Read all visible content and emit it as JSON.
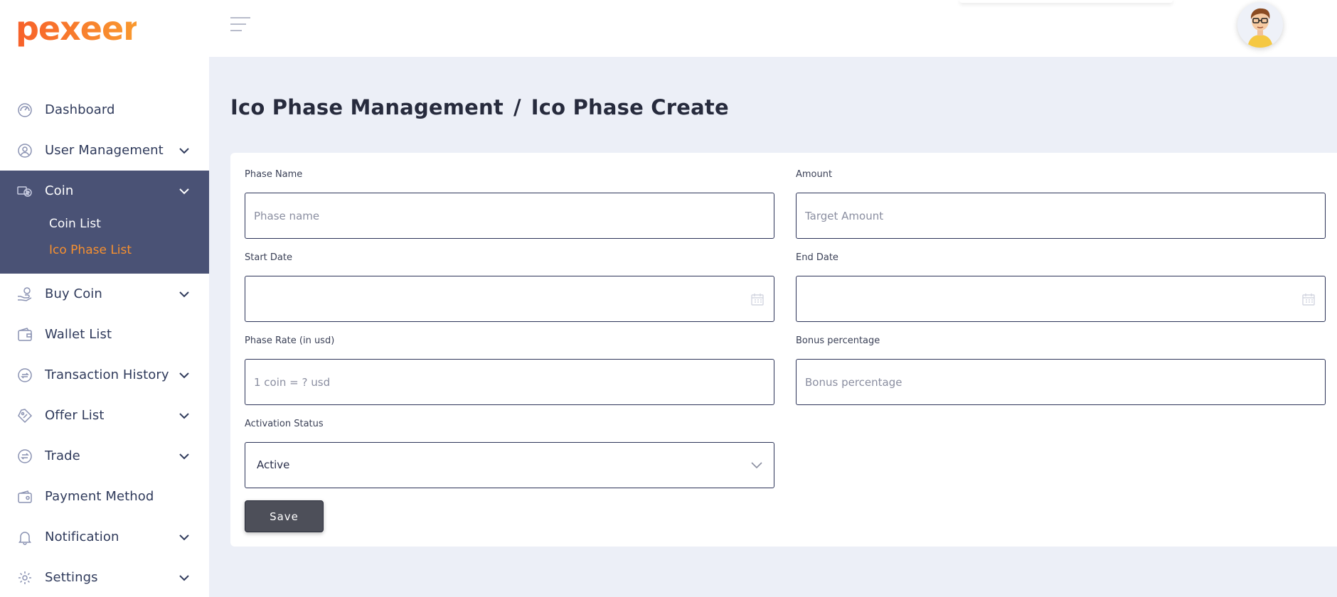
{
  "brand": {
    "name": "pexeer",
    "color": "#f7702b"
  },
  "colors": {
    "sidebar_active_bg": "#4a5275",
    "active_sub": "#f7902f",
    "page_bg": "#eceff7"
  },
  "sidebar": {
    "items": [
      {
        "label": "Dashboard",
        "icon": "speedometer-icon",
        "has_children": false
      },
      {
        "label": "User Management",
        "icon": "user-circle-icon",
        "has_children": true
      },
      {
        "label": "Coin",
        "icon": "coins-icon",
        "has_children": true,
        "open": true,
        "children": [
          {
            "label": "Coin List"
          },
          {
            "label": "Ico Phase List",
            "active": true
          }
        ]
      },
      {
        "label": "Buy Coin",
        "icon": "hand-coin-icon",
        "has_children": true
      },
      {
        "label": "Wallet List",
        "icon": "wallet-icon",
        "has_children": false
      },
      {
        "label": "Transaction History",
        "icon": "transaction-icon",
        "has_children": true
      },
      {
        "label": "Offer List",
        "icon": "offer-tag-icon",
        "has_children": true
      },
      {
        "label": "Trade",
        "icon": "exchange-icon",
        "has_children": true
      },
      {
        "label": "Payment Method",
        "icon": "payment-wallet-icon",
        "has_children": false
      },
      {
        "label": "Notification",
        "icon": "bell-icon",
        "has_children": true
      },
      {
        "label": "Settings",
        "icon": "gear-icon",
        "has_children": true
      }
    ]
  },
  "header": {
    "menu_icon": "hamburger-icon",
    "avatar": "user-avatar"
  },
  "breadcrumb": {
    "parent": "Ico Phase Management",
    "separator": "/",
    "current": "Ico Phase Create"
  },
  "form": {
    "phase_name": {
      "label": "Phase Name",
      "placeholder": "Phase name",
      "value": ""
    },
    "amount": {
      "label": "Amount",
      "placeholder": "Target Amount",
      "value": ""
    },
    "start_date": {
      "label": "Start Date",
      "value": ""
    },
    "end_date": {
      "label": "End Date",
      "value": ""
    },
    "phase_rate": {
      "label": "Phase Rate (in usd)",
      "placeholder": "1 coin = ? usd",
      "value": ""
    },
    "bonus": {
      "label": "Bonus percentage",
      "placeholder": "Bonus percentage",
      "value": ""
    },
    "activation_status": {
      "label": "Activation Status",
      "selected": "Active"
    },
    "save_label": "Save"
  }
}
